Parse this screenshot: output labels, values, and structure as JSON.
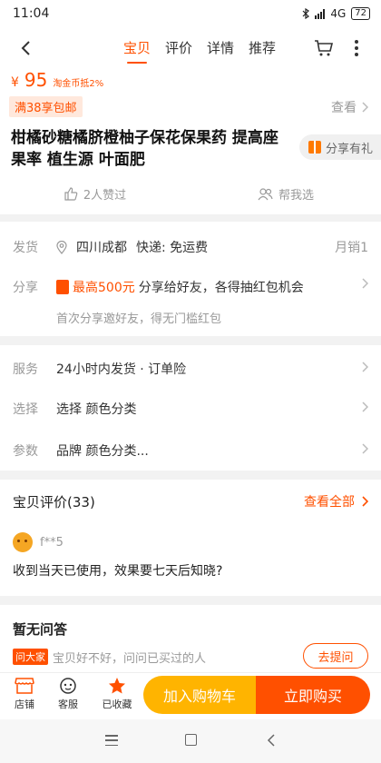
{
  "status_bar": {
    "time": "11:04",
    "network": "4G",
    "battery": "72"
  },
  "nav": {
    "tabs": [
      {
        "label": "宝贝",
        "active": true
      },
      {
        "label": "评价",
        "active": false
      },
      {
        "label": "详情",
        "active": false
      },
      {
        "label": "推荐",
        "active": false
      }
    ]
  },
  "product": {
    "price_symbol": "¥",
    "price": "95",
    "price_note": "淘金币抵2%",
    "promo_badge": "满38享包邮",
    "promo_view": "查看",
    "title": "柑橘砂糖橘脐橙柚子保花保果药  提高座果率    植生源  叶面肥",
    "share_gift": "分享有礼",
    "likes": "2人赞过",
    "help_choose": "帮我选"
  },
  "shipping": {
    "label": "发货",
    "location": "四川成都",
    "fee": "快递: 免运费",
    "monthly_sales": "月销1",
    "share_label": "分享",
    "share_max": "最高500元",
    "share_text": "分享给好友，各得抽红包机会",
    "share_sub": "首次分享邀好友，得无门槛红包"
  },
  "service": {
    "rows": [
      {
        "label": "服务",
        "value": "24小时内发货 · 订单险"
      },
      {
        "label": "选择",
        "value": "选择 颜色分类"
      },
      {
        "label": "参数",
        "value": "品牌 颜色分类..."
      }
    ]
  },
  "reviews": {
    "title": "宝贝评价(33)",
    "view_all": "查看全部",
    "user": "f**5",
    "text": "收到当天已使用，效果要七天后知晓?"
  },
  "qa": {
    "title": "暂无问答",
    "badge": "问大家",
    "text": "宝贝好不好，问问已买过的人",
    "ask_button": "去提问"
  },
  "bottom_bar": {
    "shop": "店铺",
    "service": "客服",
    "favorited": "已收藏",
    "add_to_cart": "加入购物车",
    "buy_now": "立即购买"
  },
  "colors": {
    "accent": "#ff5000",
    "cart_button": "#ffb400"
  }
}
